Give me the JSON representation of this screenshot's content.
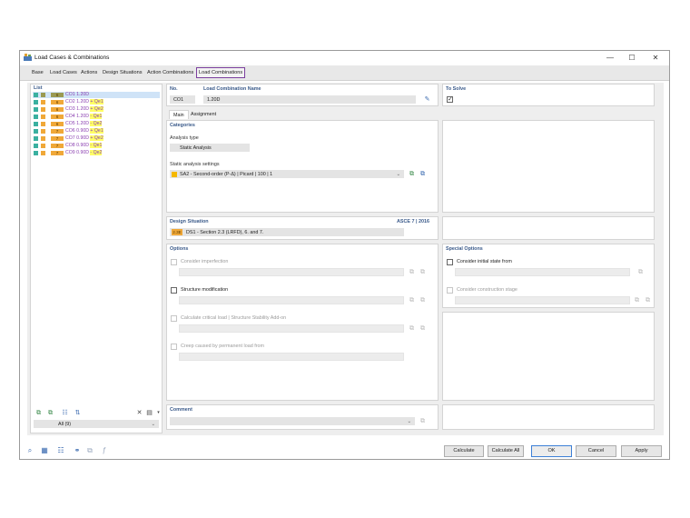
{
  "window": {
    "title": "Load Cases & Combinations",
    "controls": {
      "minimize": "—",
      "maximize": "☐",
      "close": "✕"
    }
  },
  "menu": {
    "items": [
      {
        "label": "Base"
      },
      {
        "label": "Load Cases"
      },
      {
        "label": "Actions"
      },
      {
        "label": "Design Situations"
      },
      {
        "label": "Action Combinations"
      },
      {
        "label": "Load Combinations"
      }
    ],
    "active_index": 5
  },
  "list": {
    "header": "List",
    "rows": [
      {
        "tag": "6",
        "name": "CO1",
        "text": "1.20D",
        "suffix": "",
        "selected": true,
        "sw1": "#3ab0a0",
        "sw2": "#9a9a52",
        "tagColor": "#9a9a52"
      },
      {
        "tag": "6",
        "name": "CO2",
        "text": "1.20D",
        "suffix": "+ Qe1",
        "selected": false,
        "sw1": "#3ab0a0",
        "sw2": "#f0a838",
        "tagColor": "#f0a838"
      },
      {
        "tag": "6",
        "name": "CO3",
        "text": "1.20D",
        "suffix": "+ Qe2",
        "selected": false,
        "sw1": "#3ab0a0",
        "sw2": "#f0a838",
        "tagColor": "#f0a838"
      },
      {
        "tag": "6",
        "name": "CO4",
        "text": "1.20D",
        "suffix": "- Qe1",
        "selected": false,
        "sw1": "#3ab0a0",
        "sw2": "#f0a838",
        "tagColor": "#f0a838"
      },
      {
        "tag": "6",
        "name": "CO5",
        "text": "1.20D",
        "suffix": "- Qe2",
        "selected": false,
        "sw1": "#3ab0a0",
        "sw2": "#f0a838",
        "tagColor": "#f0a838"
      },
      {
        "tag": "7",
        "name": "CO6",
        "text": "0.90D",
        "suffix": "+ Qe1",
        "selected": false,
        "sw1": "#3ab0a0",
        "sw2": "#f0a838",
        "tagColor": "#f0a838"
      },
      {
        "tag": "7",
        "name": "CO7",
        "text": "0.90D",
        "suffix": "+ Qe2",
        "selected": false,
        "sw1": "#3ab0a0",
        "sw2": "#f0a838",
        "tagColor": "#f0a838"
      },
      {
        "tag": "7",
        "name": "CO8",
        "text": "0.90D",
        "suffix": "- Qe1",
        "selected": false,
        "sw1": "#3ab0a0",
        "sw2": "#f0a838",
        "tagColor": "#f0a838"
      },
      {
        "tag": "7",
        "name": "CO9",
        "text": "0.90D",
        "suffix": "- Qe2",
        "selected": false,
        "sw1": "#3ab0a0",
        "sw2": "#f0a838",
        "tagColor": "#f0a838"
      }
    ],
    "filter_value": "All (9)"
  },
  "header": {
    "no_label": "No.",
    "no_value": "CO1",
    "name_label": "Load Combination Name",
    "name_value": "1.20D",
    "to_solve_label": "To Solve",
    "to_solve_checked": true
  },
  "tabs": [
    {
      "label": "Main"
    },
    {
      "label": "Assignment"
    }
  ],
  "categories": {
    "header": "Categories",
    "analysis_type_label": "Analysis type",
    "analysis_type_value": "Static Analysis",
    "static_settings_label": "Static analysis settings",
    "static_settings_value": "SA2 - Second-order (P-Δ) | Picard | 100 | 1"
  },
  "design_situation": {
    "header": "Design Situation",
    "standard": "ASCE 7 | 2016",
    "tag": "2.3E",
    "value": "DS1 - Section 2.3 (LRFD), 6. and 7."
  },
  "options": {
    "header": "Options",
    "items": [
      {
        "label": "Consider imperfection",
        "enabled": false
      },
      {
        "label": "Structure modification",
        "enabled": true
      },
      {
        "label": "Calculate critical load | Structure Stability Add-on",
        "enabled": false
      },
      {
        "label": "Creep caused by permanent load from",
        "enabled": false
      }
    ]
  },
  "special_options": {
    "header": "Special Options",
    "items": [
      {
        "label": "Consider initial state from",
        "enabled": true
      },
      {
        "label": "Consider construction stage",
        "enabled": false
      }
    ]
  },
  "comment": {
    "header": "Comment",
    "value": ""
  },
  "buttons": {
    "calculate": "Calculate",
    "calculate_all": "Calculate All",
    "ok": "OK",
    "cancel": "Cancel",
    "apply": "Apply"
  },
  "colors": {
    "accent": "#7b3f9e",
    "header_text": "#3a5a8a",
    "highlight": "#ffff66",
    "selection": "#cfe3f7"
  }
}
